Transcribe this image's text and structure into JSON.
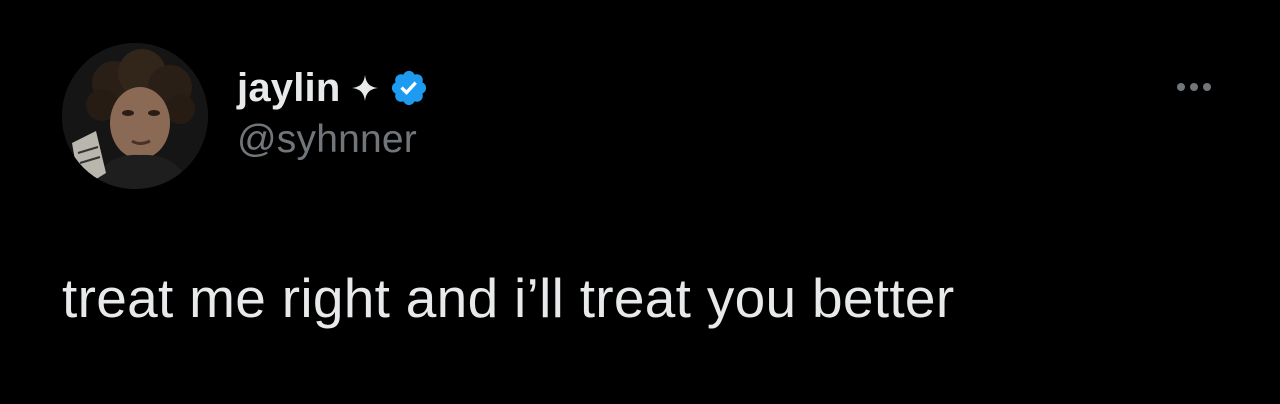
{
  "tweet": {
    "author": {
      "display_name": "jaylin",
      "handle": "@syhnner",
      "badge_icon": "sparkle-icon",
      "verified_icon": "verified-badge-icon",
      "verified_color": "#1d9bf0"
    },
    "more_icon": "more-options-icon",
    "text": "treat me right and i’ll treat you better"
  },
  "colors": {
    "background": "#000000",
    "primary_text": "#e7e9ea",
    "secondary_text": "#71767b",
    "accent": "#1d9bf0"
  }
}
